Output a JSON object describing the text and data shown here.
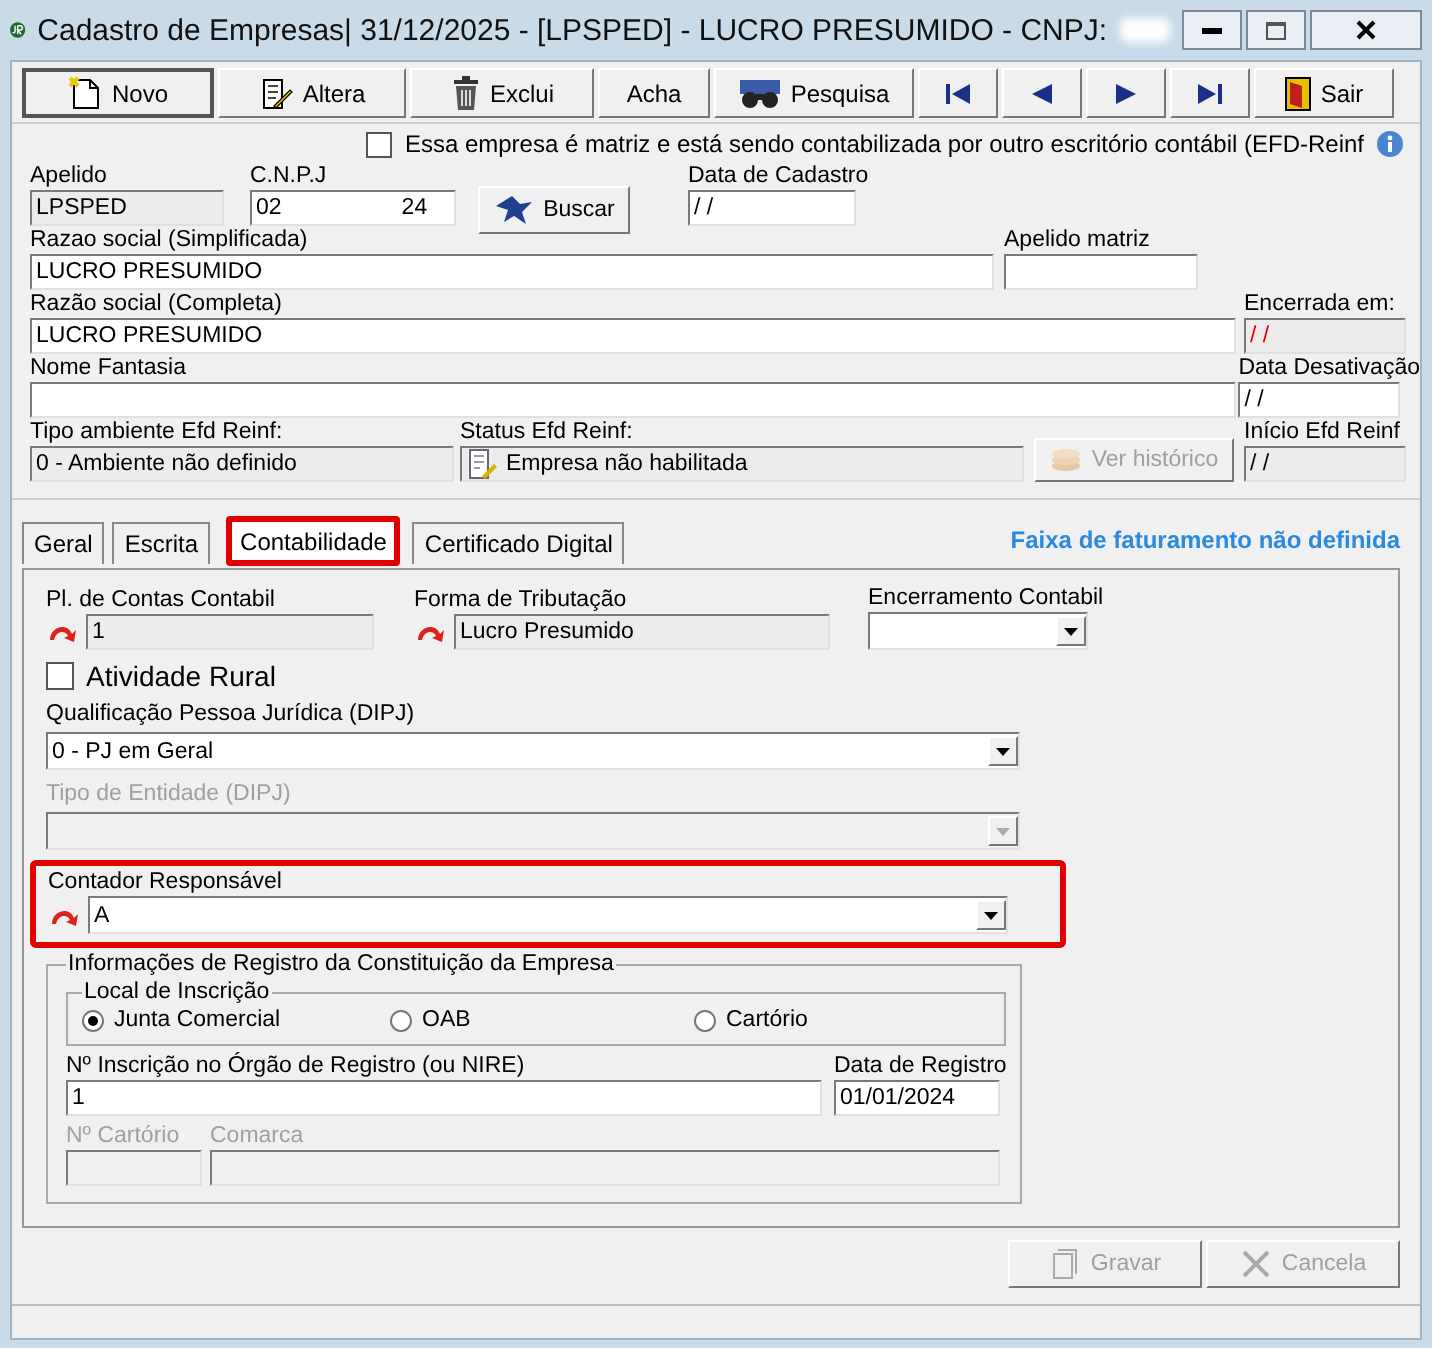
{
  "window": {
    "title": "Cadastro de Empresas|  31/12/2025 - [LPSPED] - LUCRO PRESUMIDO - CNPJ:"
  },
  "toolbar": [
    {
      "kind": "new",
      "label": "Novo"
    },
    {
      "kind": "edit",
      "label": "Altera"
    },
    {
      "kind": "delete",
      "label": "Exclui"
    },
    {
      "kind": "text",
      "label": "Acha"
    },
    {
      "kind": "search",
      "label": "Pesquisa"
    },
    {
      "kind": "first"
    },
    {
      "kind": "prev"
    },
    {
      "kind": "next"
    },
    {
      "kind": "last"
    },
    {
      "kind": "exit",
      "label": "Sair"
    }
  ],
  "matriz_checkbox": {
    "label": "Essa empresa é matriz e está sendo contabilizada por outro escritório contábil (EFD-Reinf",
    "checked": false
  },
  "company": {
    "apelido": {
      "label": "Apelido",
      "value": "LPSPED",
      "readonly": true
    },
    "cnpj": {
      "label": "C.N.P.J",
      "value": "02",
      "value_end": "24",
      "readonly": false
    },
    "buscar_button": {
      "label": "Buscar"
    },
    "data_cadastro": {
      "label": "Data de Cadastro",
      "value": "/ /",
      "readonly": false
    },
    "razao_simplificada": {
      "label": "Razao social (Simplificada)",
      "value": "LUCRO PRESUMIDO",
      "readonly": false
    },
    "apelido_matriz": {
      "label": "Apelido matriz",
      "readonly": false
    },
    "razao_completa": {
      "label": "Razão social (Completa)",
      "value": "LUCRO PRESUMIDO",
      "readonly": false
    },
    "encerrada_em": {
      "label": "Encerrada em:",
      "value": "/ /",
      "readonly": true,
      "warning": true
    },
    "nome_fantasia": {
      "label": "Nome Fantasia",
      "readonly": false
    },
    "data_desativacao": {
      "label": "Data Desativação",
      "value": "/ /",
      "readonly": false
    },
    "tipo_ambiente": {
      "label": "Tipo ambiente Efd Reinf:",
      "value": "0 - Ambiente não definido",
      "readonly": true
    },
    "status_reinf": {
      "label": "Status Efd Reinf:",
      "value": "Empresa não habilitada",
      "readonly": true
    },
    "ver_historico": {
      "label": "Ver histórico",
      "disabled": true
    },
    "inicio_reinf": {
      "label": "Início Efd Reinf",
      "value": "/ /",
      "readonly": true
    }
  },
  "tabs": [
    {
      "label": "Geral",
      "selected": false,
      "highlighted": false
    },
    {
      "label": "Escrita",
      "selected": false,
      "highlighted": false
    },
    {
      "label": "Contabilidade",
      "selected": true,
      "highlighted": true
    },
    {
      "label": "Certificado Digital",
      "selected": false,
      "highlighted": false
    }
  ],
  "faixa_notice": "Faixa de faturamento não definida",
  "contabilidade": {
    "plano_contas": {
      "label": "Pl. de Contas Contabil",
      "value": "1",
      "readonly": true
    },
    "forma_tributacao": {
      "label": "Forma de Tributação",
      "value": "Lucro Presumido",
      "readonly": true
    },
    "encerramento": {
      "label": "Encerramento Contabil",
      "disabled": false
    },
    "atividade_rural": {
      "label": "Atividade Rural",
      "checked": false
    },
    "qualificacao": {
      "label": "Qualificação Pessoa Jurídica (DIPJ)",
      "value": "0 - PJ em Geral",
      "disabled": false
    },
    "tipo_entidade": {
      "label": "Tipo de Entidade (DIPJ)",
      "disabled": true
    },
    "contador": {
      "label": "Contador Responsável",
      "value": "A",
      "disabled": false,
      "highlighted": true
    },
    "registro": {
      "title": "Informações de Registro da Constituição da Empresa",
      "local_title": "Local de Inscrição",
      "locais": [
        {
          "label": "Junta Comercial",
          "selected": true
        },
        {
          "label": "OAB",
          "selected": false
        },
        {
          "label": "Cartório",
          "selected": false
        }
      ],
      "nire": {
        "label": "Nº Inscrição no Órgão de Registro (ou NIRE)",
        "value": "1",
        "disabled": false
      },
      "data_registro": {
        "label": "Data de Registro",
        "value": "01/01/2024",
        "disabled": false
      },
      "cartorio": {
        "label": "Nº Cartório",
        "disabled": true
      },
      "comarca": {
        "label": "Comarca",
        "disabled": true
      }
    }
  },
  "footer_buttons": [
    {
      "kind": "save",
      "label": "Gravar",
      "disabled": true
    },
    {
      "kind": "cancel",
      "label": "Cancela",
      "disabled": true
    }
  ]
}
